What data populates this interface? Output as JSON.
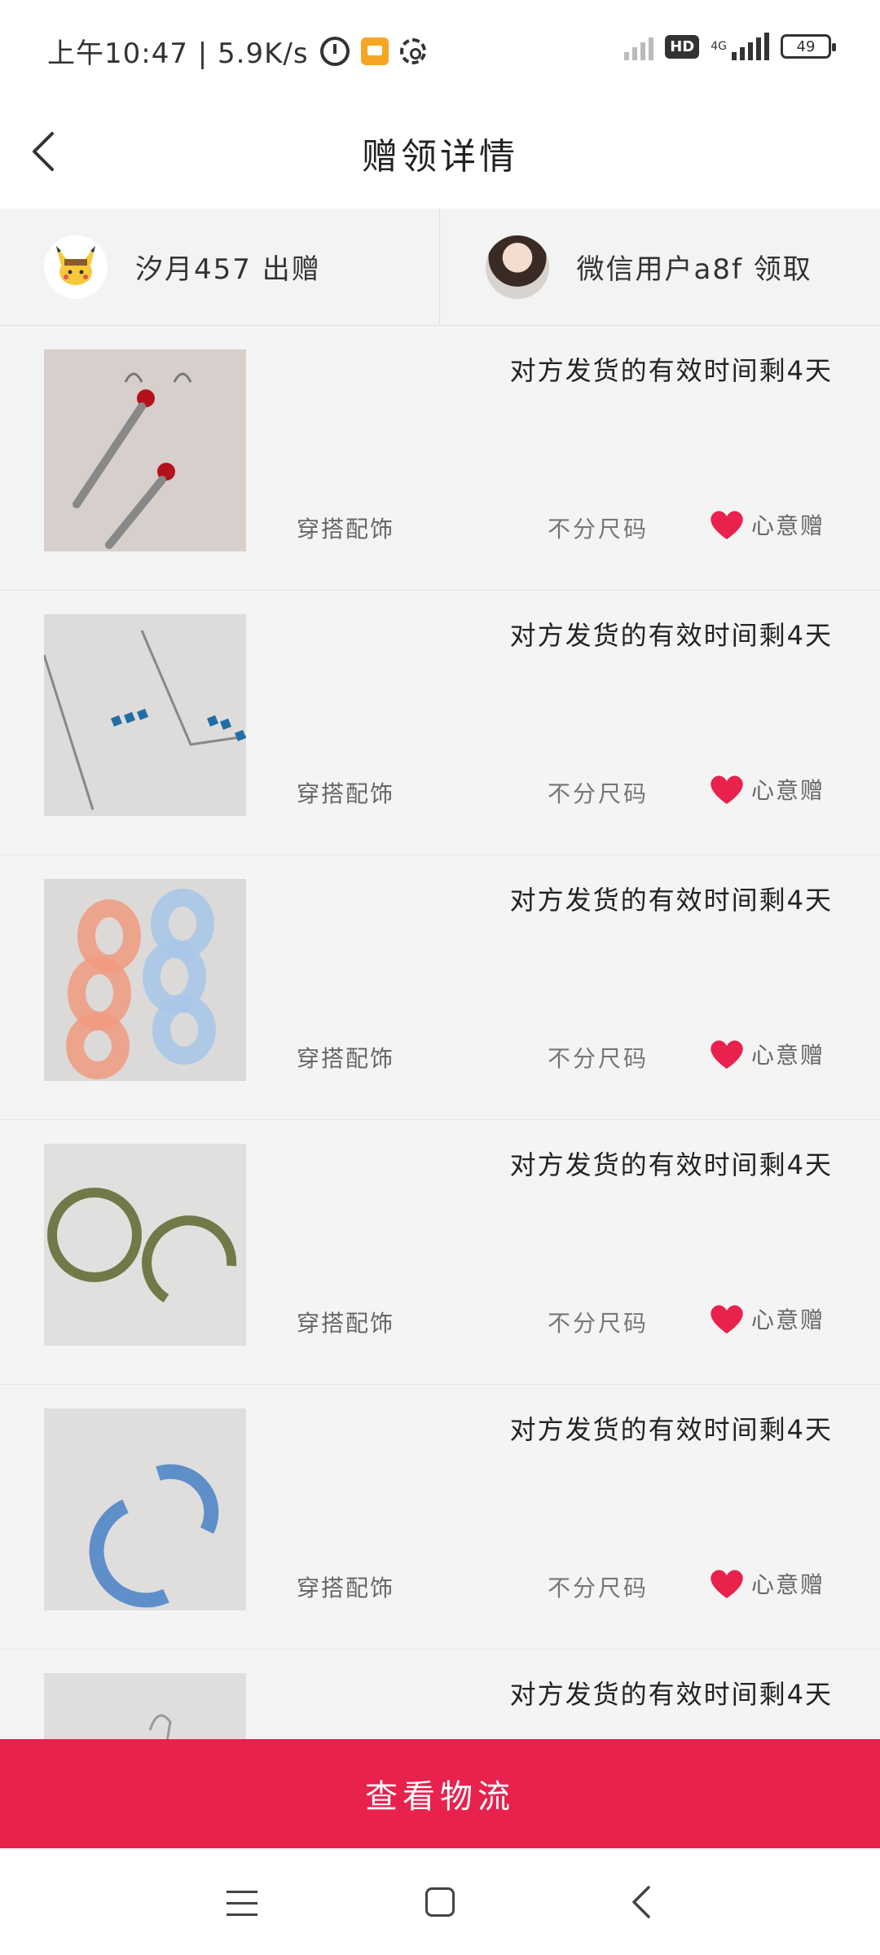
{
  "status_bar": {
    "time_speed": "上午10:47 | 5.9K/s",
    "hd": "HD",
    "network": "4G",
    "battery": "49",
    "alarm_icon": "alarm-icon",
    "message_icon": "message-icon",
    "settings_icon": "gear-icon"
  },
  "header": {
    "title": "赠领详情",
    "back_icon": "chevron-left-icon"
  },
  "users": {
    "giver": "汐月457 出赠",
    "receiver": "微信用户a8f 领取"
  },
  "items": [
    {
      "title": "对方发货的有效时间剩4天",
      "category": "穿搭配饰",
      "size": "不分尺码",
      "tag": "心意赠",
      "image": "feather-earrings"
    },
    {
      "title": "对方发货的有效时间剩4天",
      "category": "穿搭配饰",
      "size": "不分尺码",
      "tag": "心意赠",
      "image": "blue-chain-earrings"
    },
    {
      "title": "对方发货的有效时间剩4天",
      "category": "穿搭配饰",
      "size": "不分尺码",
      "tag": "心意赠",
      "image": "acrylic-link-earrings"
    },
    {
      "title": "对方发货的有效时间剩4天",
      "category": "穿搭配饰",
      "size": "不分尺码",
      "tag": "心意赠",
      "image": "green-hoop-earrings"
    },
    {
      "title": "对方发货的有效时间剩4天",
      "category": "穿搭配饰",
      "size": "不分尺码",
      "tag": "心意赠",
      "image": "blue-hoop-earrings"
    },
    {
      "title": "对方发货的有效时间剩4天",
      "category": "",
      "size": "",
      "tag": "",
      "image": "hook-earrings"
    }
  ],
  "bottom_button": "查看物流",
  "colors": {
    "accent": "#e8214d",
    "heart": "#e8214d",
    "background": "#f4f4f4"
  }
}
